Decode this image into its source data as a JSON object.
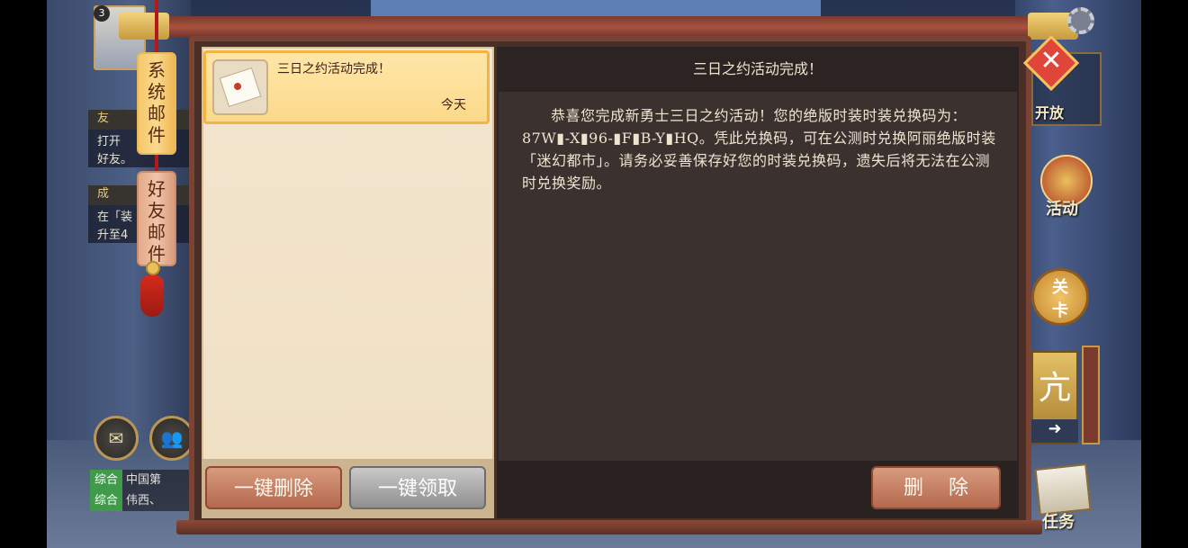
{
  "hud": {
    "level": "3",
    "side_notes": [
      {
        "header": "友",
        "text": "打开\n好友。"
      },
      {
        "header": "成",
        "text": "在「装\n升至4"
      }
    ],
    "chat": [
      {
        "tag": "综合",
        "text": "中国第"
      },
      {
        "tag": "综合",
        "text": "伟西、"
      }
    ]
  },
  "mail_tabs": [
    {
      "label": "系统邮件",
      "active": true
    },
    {
      "label": "好友邮件",
      "active": false
    }
  ],
  "mail_list": {
    "items": [
      {
        "title": "三日之约活动完成！",
        "date": "今天",
        "selected": true
      }
    ],
    "delete_all_label": "一键删除",
    "claim_all_label": "一键领取"
  },
  "mail_view": {
    "title": "三日之约活动完成！",
    "body": "恭喜您完成新勇士三日之约活动！您的绝版时装时装兑换码为：87W▮-X▮96-▮F▮B-Y▮HQ。凭此兑换码，可在公测时兑换阿丽绝版时装「迷幻都市」。请务必妥善保存好您的时装兑换码，遗失后将无法在公测时兑换奖励。",
    "delete_label": "删除"
  },
  "right_hud": {
    "open_label": "开放",
    "activity_label": "活动",
    "stage_label": "关卡",
    "card_glyph": "亢",
    "task_label": "任务"
  },
  "colors": {
    "selected_item_border": "#f2b443",
    "delete_button": "#c47a5e",
    "claim_button_disabled": "#a9a9a9",
    "close_button": "#e0453a"
  }
}
